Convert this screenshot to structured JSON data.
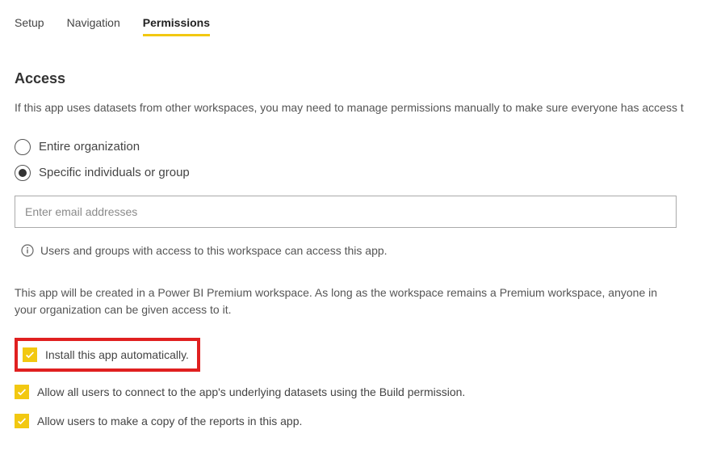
{
  "tabs": {
    "setup": "Setup",
    "navigation": "Navigation",
    "permissions": "Permissions"
  },
  "section": {
    "title": "Access",
    "intro": "If this app uses datasets from other workspaces, you may need to manage permissions manually to make sure everyone has access t"
  },
  "radios": {
    "entire": "Entire organization",
    "specific": "Specific individuals or group"
  },
  "email": {
    "placeholder": "Enter email addresses"
  },
  "hint": "Users and groups with access to this workspace can access this app.",
  "premium": "This app will be created in a Power BI Premium workspace. As long as the workspace remains a Premium workspace, anyone in your organization can be given access to it.",
  "checkboxes": {
    "install": "Install this app automatically.",
    "build": "Allow all users to connect to the app's underlying datasets using the Build permission.",
    "copy": "Allow users to make a copy of the reports in this app."
  }
}
